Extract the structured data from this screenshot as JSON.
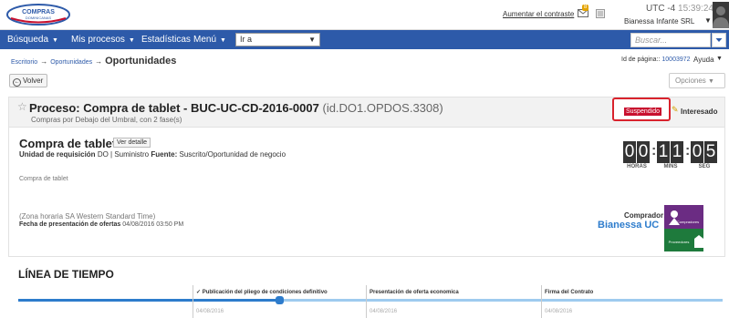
{
  "brand": {
    "logo_line1": "COMPRAS",
    "logo_line2": "DOMINICANAS"
  },
  "header": {
    "contrast_link": "Aumentar el contraste",
    "mail_badge": "8",
    "timezone": "UTC -4",
    "time": "15:39:24",
    "user": "Bianessa Infante SRL"
  },
  "nav": {
    "items": [
      {
        "label": "Búsqueda"
      },
      {
        "label": "Mis procesos"
      },
      {
        "label": "Estadísticas"
      },
      {
        "label": "Menú"
      }
    ],
    "goto_value": "Ir a",
    "search_placeholder": "Buscar..."
  },
  "breadcrumb": {
    "root": "Escritorio",
    "parent": "Oportunidades",
    "current": "Oportunidades"
  },
  "page_info": {
    "id_label": "Id de página::",
    "id_value": "10003972",
    "help": "Ayuda"
  },
  "toolbar": {
    "back": "Volver",
    "options": "Opciones"
  },
  "process": {
    "title": "Proceso: Compra de tablet - BUC-UC-CD-2016-0007",
    "id": "(id.DO1.OPDOS.3308)",
    "subtitle": "Compras por Debajo del Umbral, con 2 fase(s)",
    "status": "Suspendido",
    "interested": "Interesado",
    "name": "Compra de tablet",
    "detail_button": "Ver detalle",
    "unit_label": "Unidad de requisición",
    "unit_value": "DO",
    "supply_label": "Suministro",
    "source_label": "Fuente:",
    "source_value": "Suscrito/Oportunidad de negocio",
    "description": "Compra de tablet",
    "timezone_note": "(Zona horaria SA Western Standard Time)",
    "deadline_label": "Fecha de presentación de ofertas",
    "deadline_value": "04/08/2016 03:50 PM",
    "buyer_label": "Comprador:",
    "buyer_name": "Bianessa UC",
    "badge_top": "Compradores",
    "badge_bottom": "Proveedores"
  },
  "countdown": {
    "hours": "00",
    "mins": "11",
    "secs": "05",
    "hours_label": "HORAS",
    "mins_label": "MINS",
    "secs_label": "SEG"
  },
  "timeline": {
    "title": "LÍNEA DE TIEMPO",
    "milestones": [
      {
        "check": "✓",
        "label": "Publicación del pliego de condiciones definitivo",
        "date": "04/08/2016"
      },
      {
        "check": "",
        "label": "Presentación de oferta economica",
        "date": "04/08/2016"
      },
      {
        "check": "",
        "label": "Firma del Contrato",
        "date": "04/08/2016"
      }
    ]
  },
  "colors": {
    "nav": "#2d5aa9",
    "status": "#c8102e",
    "link": "#2d7ccc",
    "brand_green": "#1e7a3c",
    "brand_purple": "#6b2c83"
  }
}
